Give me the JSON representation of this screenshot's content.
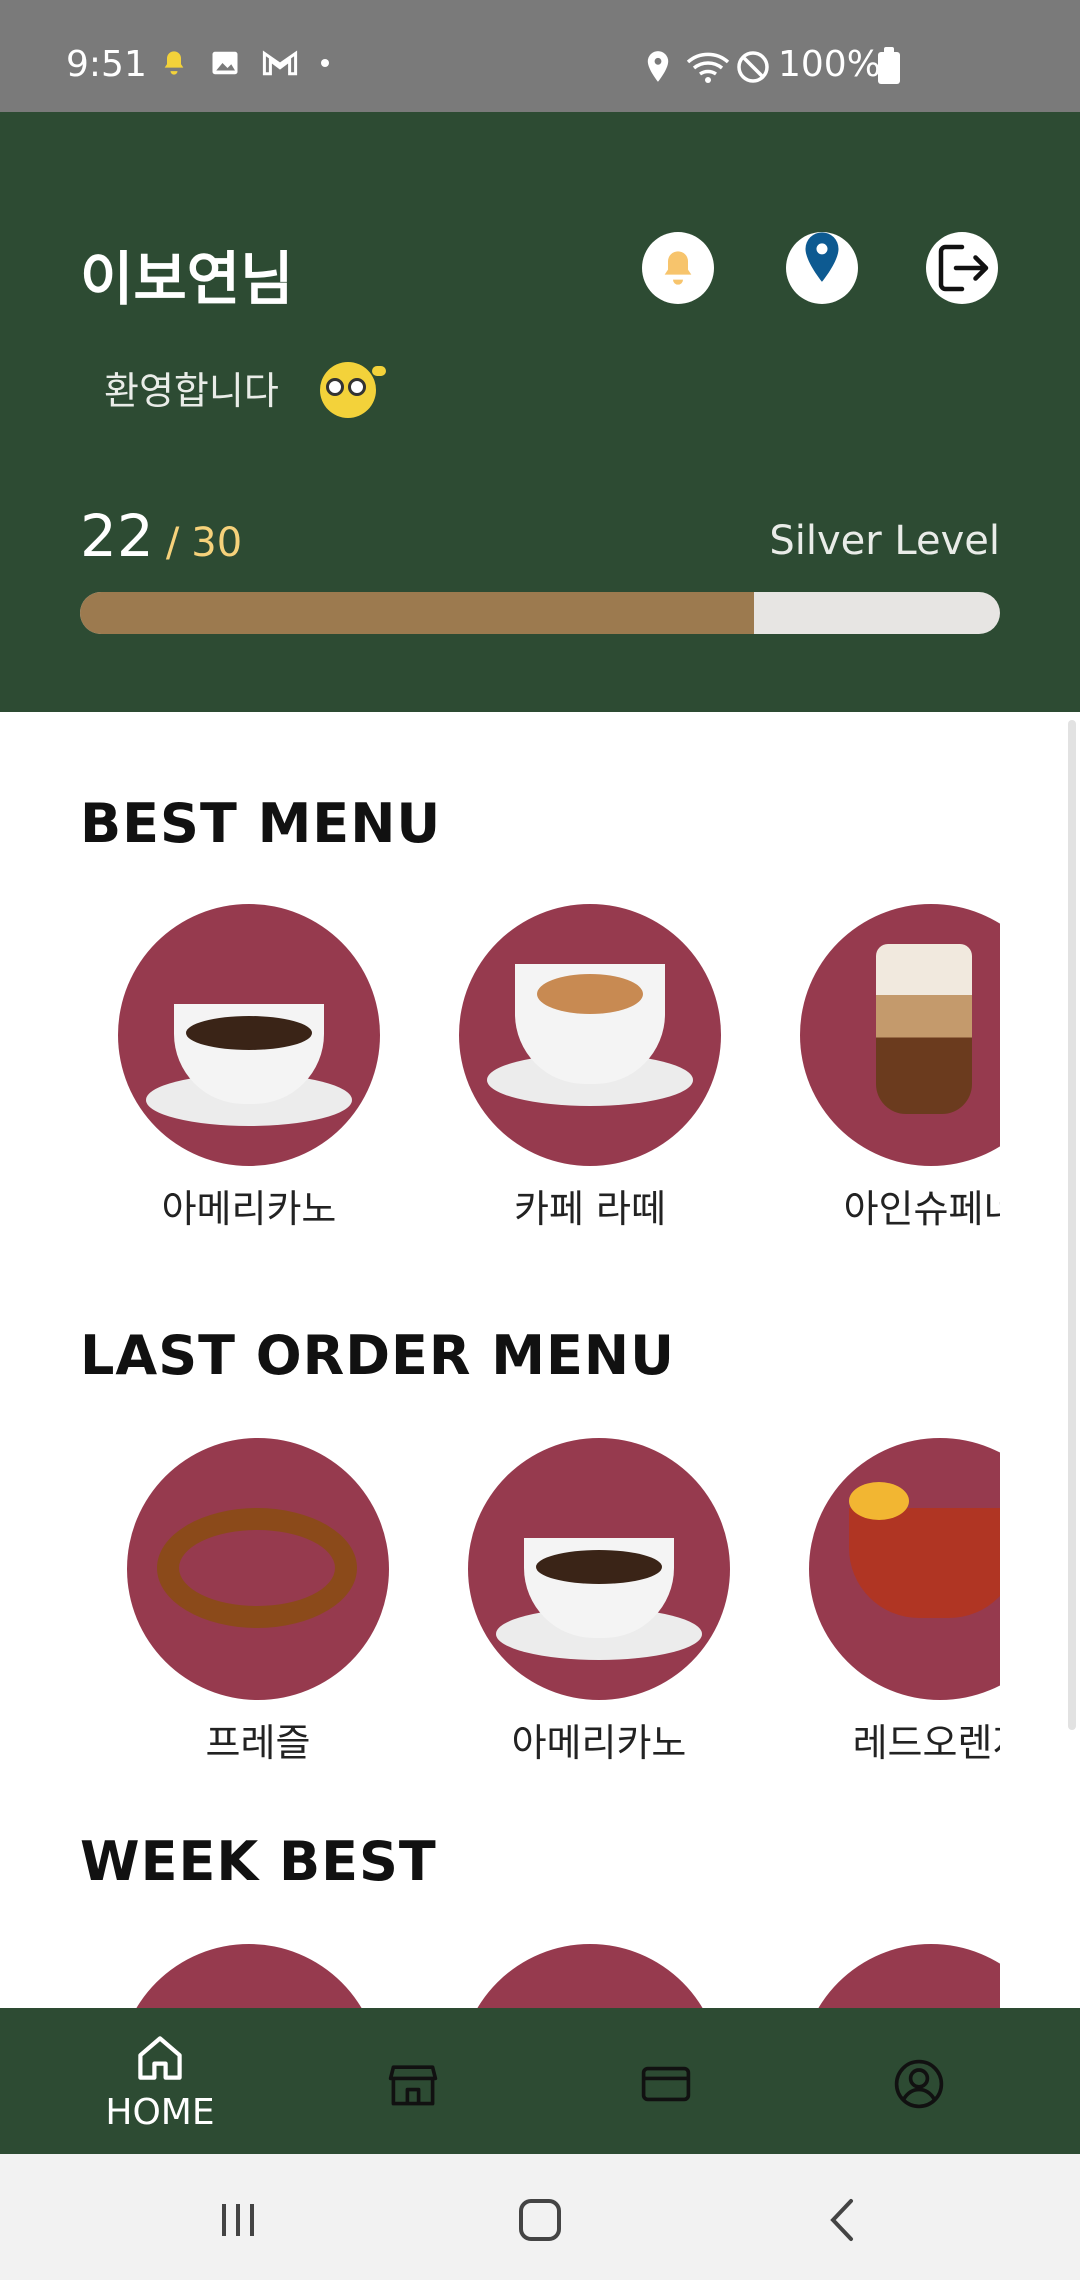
{
  "status_bar": {
    "time": "9:51",
    "battery_text": "100%"
  },
  "header": {
    "user_name": "이보연님",
    "welcome": "환영합니다",
    "points_current": "22",
    "points_separator": "/",
    "points_max": "30",
    "level_label": "Silver Level",
    "progress_fraction": 0.733,
    "colors": {
      "background": "#2d4b33",
      "progress_fill": "#9c7a4f",
      "progress_track": "#e7e5e3"
    }
  },
  "sections": {
    "best_menu": {
      "title": "BEST MENU",
      "items": [
        {
          "label": "아메리카노",
          "icon": "americano-image"
        },
        {
          "label": "카페 라떼",
          "icon": "latte-image"
        },
        {
          "label": "아인슈페너",
          "icon": "einspanner-image"
        }
      ]
    },
    "last_order_menu": {
      "title": "LAST ORDER MENU",
      "items": [
        {
          "label": "프레즐",
          "icon": "pretzel-image"
        },
        {
          "label": "아메리카노",
          "icon": "americano-image"
        },
        {
          "label": "레드오렌지",
          "icon": "red-orange-tea-image"
        }
      ]
    },
    "week_best": {
      "title": "WEEK BEST"
    }
  },
  "bottom_nav": {
    "home_label": "HOME"
  },
  "colors": {
    "circle": "#963a4e"
  }
}
